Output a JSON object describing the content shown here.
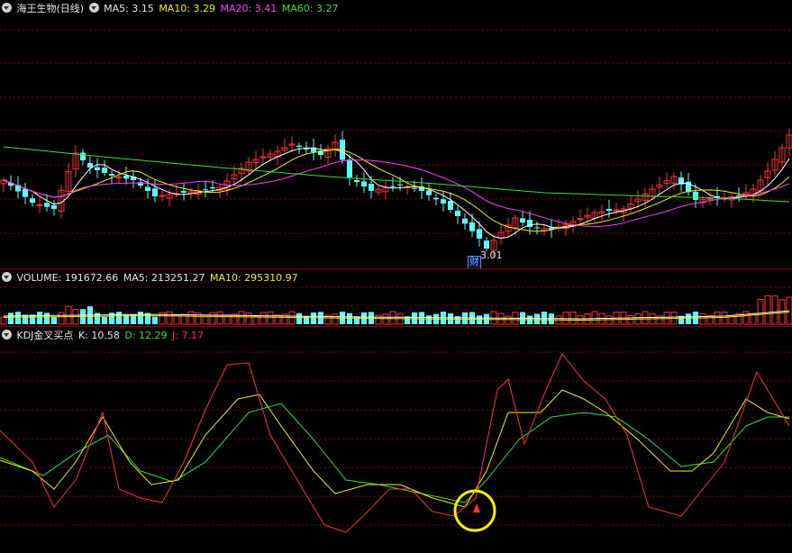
{
  "main": {
    "title": "海王生物(日线)",
    "ma5": "MA5: 3.15",
    "ma10": "MA10: 3.29",
    "ma20": "MA20: 3.41",
    "ma60": "MA60: 3.27",
    "low_price_label": "3.01",
    "event_marker": "财"
  },
  "volume": {
    "title": "VOLUME: 191672.66",
    "ma5": "MA5: 213251.27",
    "ma10": "MA10: 295310.97"
  },
  "kdj": {
    "title": "KDJ金叉买点",
    "k": "K: 10.58",
    "d": "D: 12.29",
    "j": "J: 7.17"
  },
  "colors": {
    "up": "#ff3232",
    "down": "#54ffff",
    "ma5": "#ffffff",
    "ma10": "#f3f000",
    "ma20": "#ff3cff",
    "ma60": "#33e033",
    "grid": "#8a0000",
    "signal_circle": "#f3f000"
  },
  "icons": [
    "collapse-triangle-icon"
  ]
}
